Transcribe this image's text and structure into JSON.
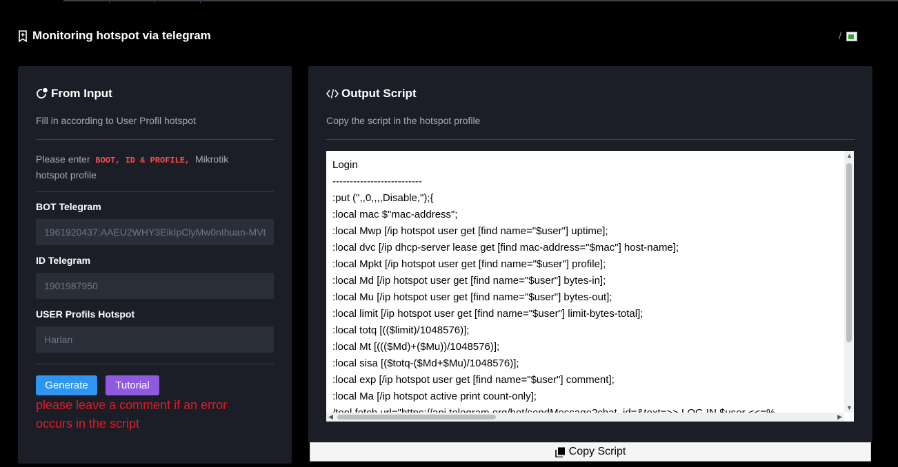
{
  "header": {
    "title": "Monitoring hotspot via telegram",
    "breadcrumb_separator": "/"
  },
  "form": {
    "title": "From Input",
    "subtitle": "Fill in according to User Profil hotspot",
    "notice_prefix": "Please enter",
    "notice_code": "BOOT, ID & PROFILE,",
    "notice_suffix_1": "Mikrotik",
    "notice_suffix_2": "hotspot profile",
    "bot_label": "BOT Telegram",
    "bot_value": "1961920437:AAEU2WHY3EikIpClyMw0nIhuan-MVt",
    "id_label": "ID Telegram",
    "id_value": "1901987950",
    "profile_label": "USER Profils Hotspot",
    "profile_value": "Harian",
    "generate_label": "Generate",
    "tutorial_label": "Tutorial",
    "error_note": "please leave a comment if an error occurs in the script"
  },
  "output": {
    "title": "Output Script",
    "subtitle": "Copy the script in the hotspot profile",
    "script": "Login\n--------------------------\n:put (\",,0,,,,Disable,\");{\n:local mac $\"mac-address\";\n:local Mwp [/ip hotspot user get [find name=\"$user\"] uptime];\n:local dvc [/ip dhcp-server lease get [find mac-address=\"$mac\"] host-name];\n:local Mpkt [/ip hotspot user get [find name=\"$user\"] profile];\n:local Md [/ip hotspot user get [find name=\"$user\"] bytes-in];\n:local Mu [/ip hotspot user get [find name=\"$user\"] bytes-out];\n:local limit [/ip hotspot user get [find name=\"$user\"] limit-bytes-total];\n:local totq [(($limit)/1048576)];\n:local Mt [((($Md)+($Mu))/1048576)];\n:local sisa [($totq-($Md+$Mu)/1048576)];\n:local exp [/ip hotspot user get [find name=\"$user\"] comment];\n:local Ma [/ip hotspot active print count-only];\n/tool fetch url=\"https://api.telegram.org/bot/sendMessage?chat_id=&text=>> LOG IN $user <<=%",
    "copy_label": "Copy Script"
  },
  "colors": {
    "background": "#000000",
    "card": "#1b1e27",
    "generate": "#2e95f0",
    "tutorial": "#8f59e0",
    "error": "#e31b23"
  }
}
